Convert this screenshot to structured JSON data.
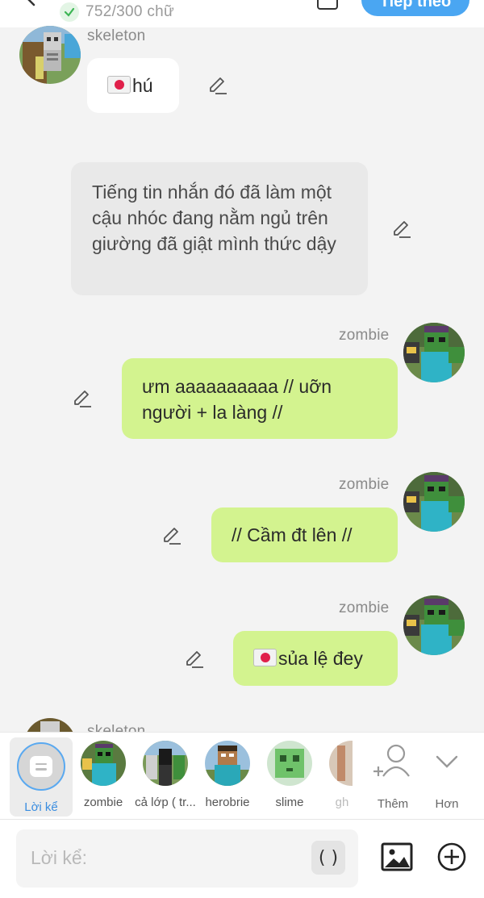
{
  "header": {
    "word_count": "752/300 chữ",
    "next_label": "Tiếp theo"
  },
  "messages": [
    {
      "sender": "skeleton",
      "text": "hú",
      "emoji": "envelope-heart"
    },
    {
      "type": "narration",
      "text": "Tiếng tin nhắn đó đã làm một cậu nhóc đang nằm ngủ trên giường đã giật mình thức dậy"
    },
    {
      "sender": "zombie",
      "lines": [
        "ưm aaaaaaaaaa // uỡn",
        "người + la làng //"
      ]
    },
    {
      "sender": "zombie",
      "text": "// Cầm đt lên //"
    },
    {
      "sender": "zombie",
      "text": "sủa lệ đey",
      "emoji": "envelope-heart"
    },
    {
      "sender": "skeleton"
    }
  ],
  "characters": {
    "narrator_label": "Lời kể",
    "items": [
      {
        "label": "zombie"
      },
      {
        "label": "cả lớp ( tr..."
      },
      {
        "label": "herobrie"
      },
      {
        "label": "slime"
      },
      {
        "label": "gh"
      }
    ],
    "add_label": "Thêm",
    "more_label": "Hơn"
  },
  "composer": {
    "placeholder": "Lời kể:",
    "paren_label": "( )"
  },
  "colors": {
    "accent": "#4aa6f2",
    "bubble_green": "#d3f38f",
    "bubble_gray": "#e9e9e9",
    "background": "#f3f3f3"
  },
  "icons": [
    "back-arrow-icon",
    "check-icon",
    "save-icon",
    "edit-icon",
    "person-add-icon",
    "chevron-down-icon",
    "image-icon",
    "plus-circle-icon",
    "envelope-heart-icon"
  ]
}
